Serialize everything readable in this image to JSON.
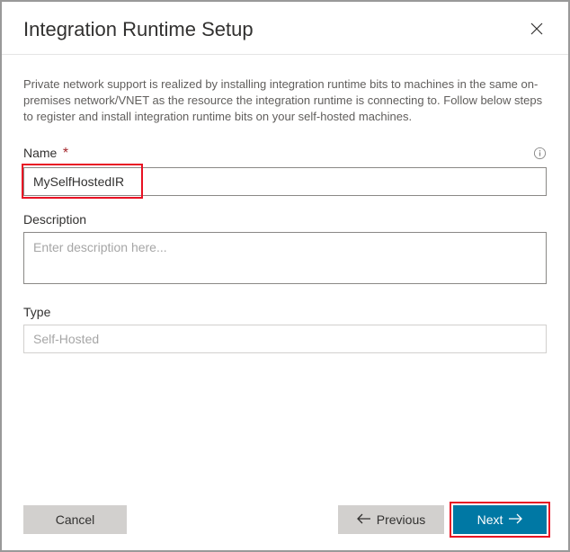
{
  "header": {
    "title": "Integration Runtime Setup"
  },
  "intro": "Private network support is realized by installing integration runtime bits to machines in the same on-premises network/VNET as the resource the integration runtime is connecting to. Follow below steps to register and install integration runtime bits on your self-hosted machines.",
  "fields": {
    "name": {
      "label": "Name",
      "value": "MySelfHostedIR"
    },
    "description": {
      "label": "Description",
      "placeholder": "Enter description here...",
      "value": ""
    },
    "type": {
      "label": "Type",
      "value": "Self-Hosted"
    }
  },
  "buttons": {
    "cancel": "Cancel",
    "previous": "Previous",
    "next": "Next"
  }
}
